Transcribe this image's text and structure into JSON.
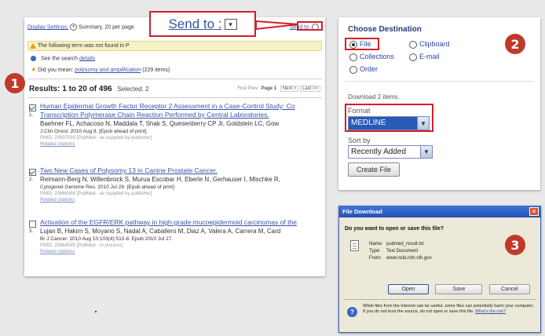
{
  "results": {
    "toolbar": {
      "display_settings": "Display Settings:",
      "summary": "Summary, 20 per page",
      "send_to_small": "Send to:"
    },
    "send_to_callout": "Send to :",
    "notice": "The following term was not found in P",
    "search_details_prefix": "See the search",
    "search_details_link": "details",
    "did_you_mean_prefix": "Did you mean:",
    "did_you_mean_link": "polysomy and amplification",
    "did_you_mean_suffix": "(229 items)",
    "heading": "Results: 1 to 20 of 496",
    "selected": "Selected: 2",
    "pager": {
      "first": "First",
      "prev": "Prev",
      "page": "Page 1",
      "next": "Next >",
      "last": "Last >>"
    },
    "items": [
      {
        "num": "1.",
        "checked": true,
        "title_line1": "Human Epidermal Growth Factor Receptor 2 Assessment in a Case-Control Study: Co",
        "title_line2": "Transcription Polymerase Chain Reaction Performed by Central Laboratories.",
        "authors": "Baehner FL, Achacoso N, Maddala T, Shak S, Quesenberry CP Jr, Goldstein LC, Gow",
        "journal": "J Clin Oncol. 2010 Aug 9. [Epub ahead of print]",
        "pmid": "PMID: 20697093 [PubMed - as supplied by publisher]",
        "related": "Related citations"
      },
      {
        "num": "2.",
        "checked": true,
        "title_line1": "Two New Cases of Polysomy 13 in Canine Prostate Cancer.",
        "title_line2": "",
        "authors": "Reimann-Berg N, Willenbrock S, Murua Escobar H, Eberle N, Gerhauser I, Mischke R,",
        "journal": "Cytogenet Genome Res. 2010 Jul 29. [Epub ahead of print]",
        "pmid": "PMID: 20668368 [PubMed - as supplied by publisher]",
        "related": "Related citations"
      },
      {
        "num": "3.",
        "checked": false,
        "title_line1": "Activation of the EGFR/ERK pathway in high-grade mucoepidermoid carcinomas of the",
        "title_line2": "",
        "authors": "Lujan B, Hakim S, Moyano S, Nadal A, Caballero M, Diaz A, Valera A, Carrera M, Card",
        "journal": "Br J Cancer. 2010 Aug 10;103(4):510-8. Epub 2010 Jul 27.",
        "pmid": "PMID: 20664595 [PubMed - in process]",
        "related": "Related citations"
      }
    ]
  },
  "destination": {
    "title": "Choose Destination",
    "options": {
      "file": "File",
      "clipboard": "Clipboard",
      "collections": "Collections",
      "email": "E-mail",
      "order": "Order"
    },
    "selected_option": "File",
    "download_label": "Download 2 items.",
    "format_label": "Format",
    "format_value": "MEDLINE",
    "sort_label": "Sort by",
    "sort_value": "Recently Added",
    "create_button": "Create File"
  },
  "dialog": {
    "title": "File Download",
    "question": "Do you want to open or save this file?",
    "name_label": "Name:",
    "name_value": "pubmed_result.txt",
    "type_label": "Type:",
    "type_value": "Text Document",
    "from_label": "From:",
    "from_value": "www.ncbi.nlm.nih.gov",
    "buttons": {
      "open": "Open",
      "save": "Save",
      "cancel": "Cancel"
    },
    "warning": "While files from the Internet can be useful, some files can potentially harm your computer. If you do not trust the source, do not open or save this file.",
    "warning_link": "What's the risk?"
  },
  "steps": [
    "1",
    "2",
    "3"
  ],
  "colors": {
    "step_red": "#c0392b",
    "highlight_red": "#d21f2b",
    "link_blue": "#3a53a4",
    "dialog_blue": "#2f5fb8"
  }
}
